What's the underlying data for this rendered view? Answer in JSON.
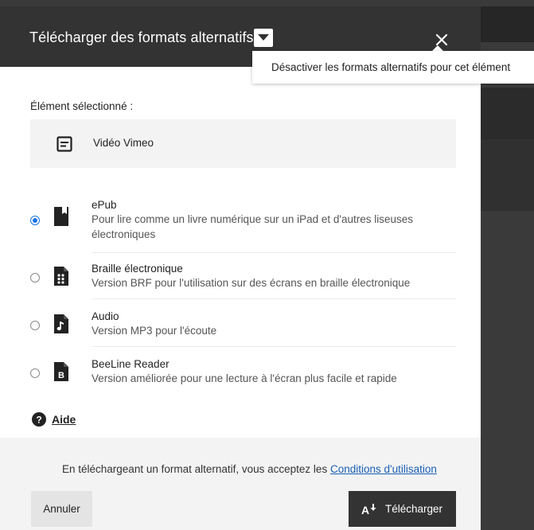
{
  "modal": {
    "title": "Télécharger des formats alternatifs",
    "tooltip": "Désactiver les formats alternatifs pour cet élément"
  },
  "selected": {
    "label": "Élément sélectionné :",
    "item_name": "Vidéo Vimeo"
  },
  "formats": [
    {
      "name": "ePub",
      "description": "Pour lire comme un livre numérique sur un iPad et d'autres liseuses électroniques",
      "selected": true,
      "icon": "book-icon"
    },
    {
      "name": "Braille électronique",
      "description": "Version BRF pour l'utilisation sur des écrans en braille électronique",
      "selected": false,
      "icon": "braille-file-icon"
    },
    {
      "name": "Audio",
      "description": "Version MP3 pour l'écoute",
      "selected": false,
      "icon": "audio-file-icon"
    },
    {
      "name": "BeeLine Reader",
      "description": "Version améliorée pour une lecture à l'écran plus facile et rapide",
      "selected": false,
      "icon": "beeline-file-icon"
    }
  ],
  "help": {
    "label": "Aide"
  },
  "footer": {
    "terms_prefix": "En téléchargeant un format alternatif, vous acceptez les ",
    "terms_link": "Conditions d'utilisation",
    "cancel_label": "Annuler",
    "download_label": "Télécharger"
  },
  "colors": {
    "header_bg": "#333333",
    "accent": "#1a73e8",
    "link": "#1a5fb4",
    "footer_bg": "#f3f3f3"
  }
}
